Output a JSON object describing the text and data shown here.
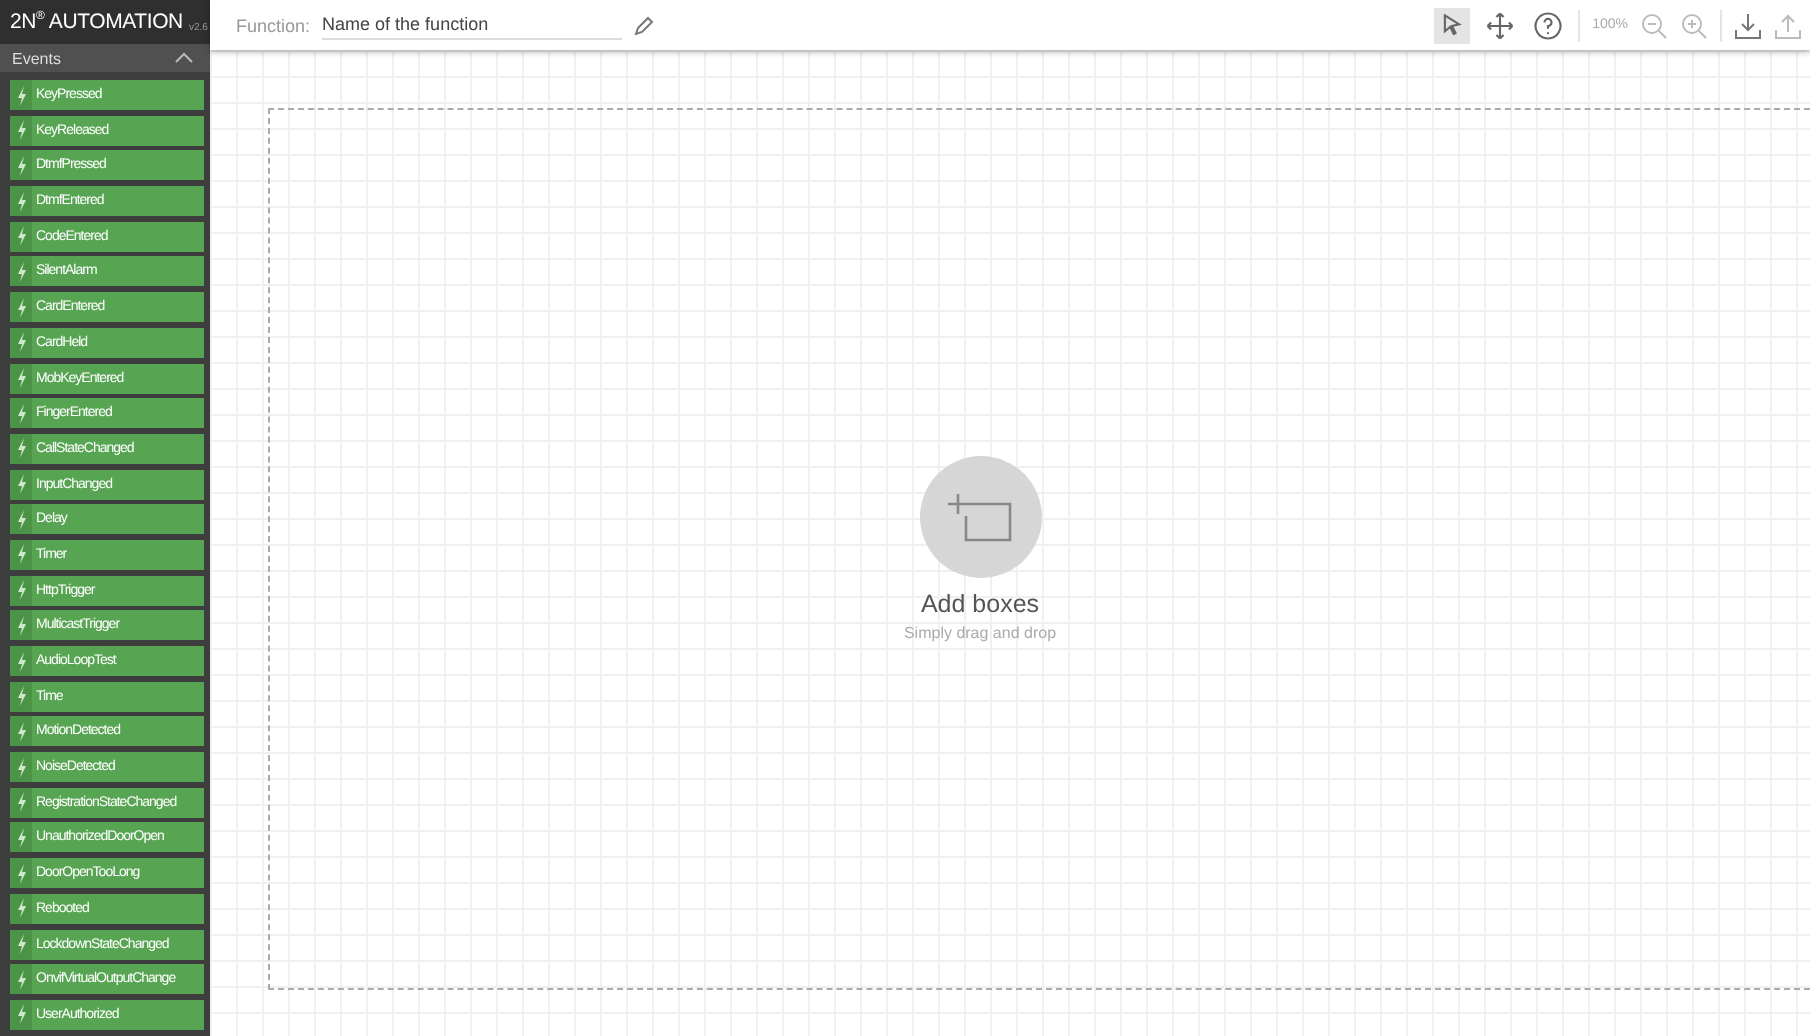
{
  "app": {
    "logo": "2N$^{®}$",
    "title": "AUTOMATION",
    "version": "v2.6"
  },
  "function": {
    "label": "Function:",
    "value": "Name of the function"
  },
  "toolbar": {
    "tools": [
      {
        "kind": "pointer",
        "selected": true
      },
      {
        "kind": "move",
        "selected": false
      },
      {
        "kind": "help",
        "selected": false
      }
    ],
    "zoom": "100%"
  },
  "sidebar": {
    "section": "Events",
    "expanded": true,
    "items": [
      "KeyPressed",
      "KeyReleased",
      "DtmfPressed",
      "DtmfEntered",
      "CodeEntered",
      "SilentAlarm",
      "CardEntered",
      "CardHeld",
      "MobKeyEntered",
      "FingerEntered",
      "CallStateChanged",
      "InputChanged",
      "Delay",
      "Timer",
      "HttpTrigger",
      "MulticastTrigger",
      "AudioLoopTest",
      "Time",
      "MotionDetected",
      "NoiseDetected",
      "RegistrationStateChanged",
      "UnauthorizedDoorOpen",
      "DoorOpenTooLong",
      "Rebooted",
      "LockdownStateChanged",
      "OnvifVirtualOutputChange",
      "UserAuthorized"
    ]
  },
  "canvas": {
    "title": "Add boxes",
    "hint": "Simply drag and drop"
  }
}
